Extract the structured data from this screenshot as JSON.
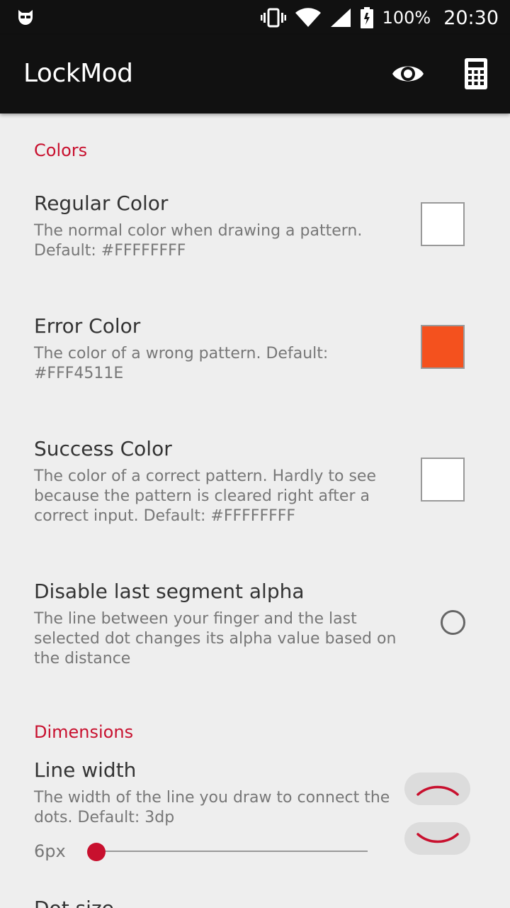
{
  "status_bar": {
    "left_icon": "incognito-mask-icon",
    "icons": [
      "vibrate-icon",
      "wifi-icon",
      "cell-signal-icon",
      "battery-icon"
    ],
    "battery": "100%",
    "time": "20:30"
  },
  "app_bar": {
    "title": "LockMod",
    "actions": [
      "eye-icon",
      "calculator-icon"
    ]
  },
  "sections": {
    "colors": {
      "header": "Colors",
      "regular": {
        "title": "Regular Color",
        "summary": "The normal color when drawing a pattern. Default: #FFFFFFFF",
        "color": "#FFFFFF"
      },
      "error": {
        "title": "Error Color",
        "summary": "The color of a wrong pattern. Default: #FFF4511E",
        "color": "#F4511E"
      },
      "success": {
        "title": "Success Color",
        "summary": "The color of a correct pattern. Hardly to see because the pattern is cleared right after a correct input. Default: #FFFFFFFF",
        "color": "#FFFFFF"
      },
      "disable_alpha": {
        "title": "Disable last segment alpha",
        "summary": "The line between your finger and the last selected dot changes its alpha value based on the distance",
        "checked": false
      }
    },
    "dimensions": {
      "header": "Dimensions",
      "line_width": {
        "title": "Line width",
        "summary": "The width of the line you draw to connect the dots. Default: 3dp",
        "value_label": "6px",
        "slider_fraction": 0.03
      },
      "next_item_title": "Dot size"
    }
  },
  "colors": {
    "accent": "#C8102E",
    "appbar": "#111111",
    "background": "#EEEEEE"
  }
}
